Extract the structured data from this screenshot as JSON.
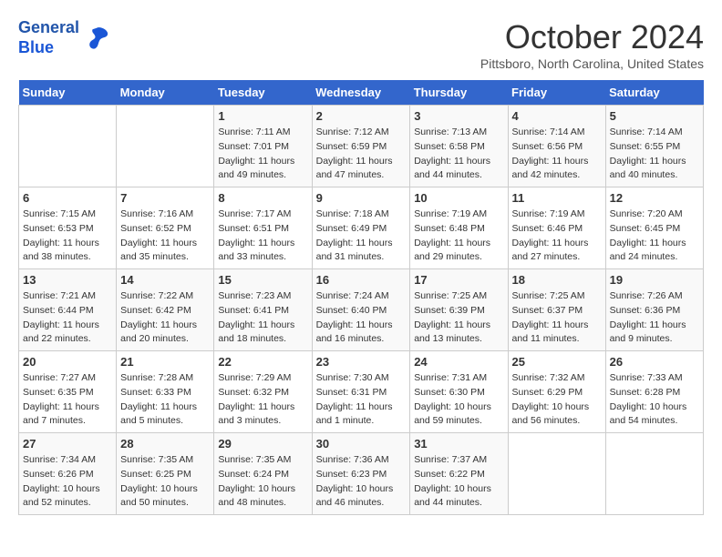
{
  "logo": {
    "line1": "General",
    "line2": "Blue"
  },
  "title": "October 2024",
  "location": "Pittsboro, North Carolina, United States",
  "days_of_week": [
    "Sunday",
    "Monday",
    "Tuesday",
    "Wednesday",
    "Thursday",
    "Friday",
    "Saturday"
  ],
  "weeks": [
    [
      {
        "day": "",
        "info": ""
      },
      {
        "day": "",
        "info": ""
      },
      {
        "day": "1",
        "info": "Sunrise: 7:11 AM\nSunset: 7:01 PM\nDaylight: 11 hours and 49 minutes."
      },
      {
        "day": "2",
        "info": "Sunrise: 7:12 AM\nSunset: 6:59 PM\nDaylight: 11 hours and 47 minutes."
      },
      {
        "day": "3",
        "info": "Sunrise: 7:13 AM\nSunset: 6:58 PM\nDaylight: 11 hours and 44 minutes."
      },
      {
        "day": "4",
        "info": "Sunrise: 7:14 AM\nSunset: 6:56 PM\nDaylight: 11 hours and 42 minutes."
      },
      {
        "day": "5",
        "info": "Sunrise: 7:14 AM\nSunset: 6:55 PM\nDaylight: 11 hours and 40 minutes."
      }
    ],
    [
      {
        "day": "6",
        "info": "Sunrise: 7:15 AM\nSunset: 6:53 PM\nDaylight: 11 hours and 38 minutes."
      },
      {
        "day": "7",
        "info": "Sunrise: 7:16 AM\nSunset: 6:52 PM\nDaylight: 11 hours and 35 minutes."
      },
      {
        "day": "8",
        "info": "Sunrise: 7:17 AM\nSunset: 6:51 PM\nDaylight: 11 hours and 33 minutes."
      },
      {
        "day": "9",
        "info": "Sunrise: 7:18 AM\nSunset: 6:49 PM\nDaylight: 11 hours and 31 minutes."
      },
      {
        "day": "10",
        "info": "Sunrise: 7:19 AM\nSunset: 6:48 PM\nDaylight: 11 hours and 29 minutes."
      },
      {
        "day": "11",
        "info": "Sunrise: 7:19 AM\nSunset: 6:46 PM\nDaylight: 11 hours and 27 minutes."
      },
      {
        "day": "12",
        "info": "Sunrise: 7:20 AM\nSunset: 6:45 PM\nDaylight: 11 hours and 24 minutes."
      }
    ],
    [
      {
        "day": "13",
        "info": "Sunrise: 7:21 AM\nSunset: 6:44 PM\nDaylight: 11 hours and 22 minutes."
      },
      {
        "day": "14",
        "info": "Sunrise: 7:22 AM\nSunset: 6:42 PM\nDaylight: 11 hours and 20 minutes."
      },
      {
        "day": "15",
        "info": "Sunrise: 7:23 AM\nSunset: 6:41 PM\nDaylight: 11 hours and 18 minutes."
      },
      {
        "day": "16",
        "info": "Sunrise: 7:24 AM\nSunset: 6:40 PM\nDaylight: 11 hours and 16 minutes."
      },
      {
        "day": "17",
        "info": "Sunrise: 7:25 AM\nSunset: 6:39 PM\nDaylight: 11 hours and 13 minutes."
      },
      {
        "day": "18",
        "info": "Sunrise: 7:25 AM\nSunset: 6:37 PM\nDaylight: 11 hours and 11 minutes."
      },
      {
        "day": "19",
        "info": "Sunrise: 7:26 AM\nSunset: 6:36 PM\nDaylight: 11 hours and 9 minutes."
      }
    ],
    [
      {
        "day": "20",
        "info": "Sunrise: 7:27 AM\nSunset: 6:35 PM\nDaylight: 11 hours and 7 minutes."
      },
      {
        "day": "21",
        "info": "Sunrise: 7:28 AM\nSunset: 6:33 PM\nDaylight: 11 hours and 5 minutes."
      },
      {
        "day": "22",
        "info": "Sunrise: 7:29 AM\nSunset: 6:32 PM\nDaylight: 11 hours and 3 minutes."
      },
      {
        "day": "23",
        "info": "Sunrise: 7:30 AM\nSunset: 6:31 PM\nDaylight: 11 hours and 1 minute."
      },
      {
        "day": "24",
        "info": "Sunrise: 7:31 AM\nSunset: 6:30 PM\nDaylight: 10 hours and 59 minutes."
      },
      {
        "day": "25",
        "info": "Sunrise: 7:32 AM\nSunset: 6:29 PM\nDaylight: 10 hours and 56 minutes."
      },
      {
        "day": "26",
        "info": "Sunrise: 7:33 AM\nSunset: 6:28 PM\nDaylight: 10 hours and 54 minutes."
      }
    ],
    [
      {
        "day": "27",
        "info": "Sunrise: 7:34 AM\nSunset: 6:26 PM\nDaylight: 10 hours and 52 minutes."
      },
      {
        "day": "28",
        "info": "Sunrise: 7:35 AM\nSunset: 6:25 PM\nDaylight: 10 hours and 50 minutes."
      },
      {
        "day": "29",
        "info": "Sunrise: 7:35 AM\nSunset: 6:24 PM\nDaylight: 10 hours and 48 minutes."
      },
      {
        "day": "30",
        "info": "Sunrise: 7:36 AM\nSunset: 6:23 PM\nDaylight: 10 hours and 46 minutes."
      },
      {
        "day": "31",
        "info": "Sunrise: 7:37 AM\nSunset: 6:22 PM\nDaylight: 10 hours and 44 minutes."
      },
      {
        "day": "",
        "info": ""
      },
      {
        "day": "",
        "info": ""
      }
    ]
  ]
}
